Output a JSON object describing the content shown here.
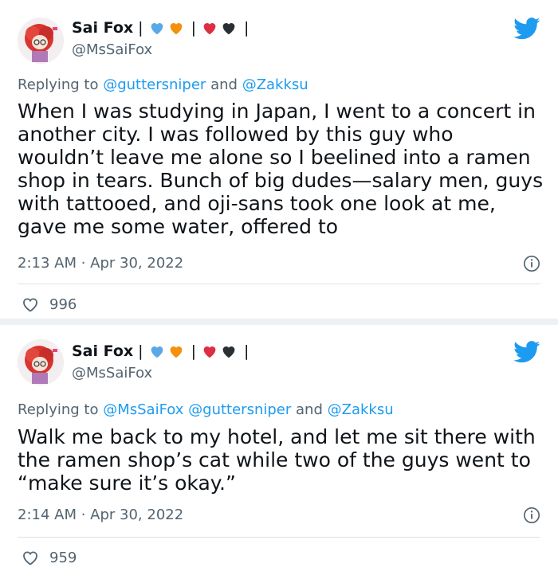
{
  "tweets": [
    {
      "name": "Sai Fox",
      "sep1": "|",
      "sep2": "|",
      "sep3": "|",
      "handle": "@MsSaiFox",
      "reply_prefix": "Replying to",
      "mentions": [
        "@guttersniper",
        "and",
        "@Zakksu"
      ],
      "text": "When I was studying in Japan, I went to a concert in another city. I was followed by this guy who wouldn’t leave me alone so I beelined into a ramen shop in tears. Bunch of big dudes—salary men, guys with tattooed, and oji-sans took one look at me, gave me some water, offered to",
      "timestamp": "2:13 AM · Apr 30, 2022",
      "likes": "996"
    },
    {
      "name": "Sai Fox",
      "sep1": "|",
      "sep2": "|",
      "sep3": "|",
      "handle": "@MsSaiFox",
      "reply_prefix": "Replying to",
      "mentions": [
        "@MsSaiFox",
        "@guttersniper",
        "and",
        "@Zakksu"
      ],
      "text": "Walk me back to my hotel, and let me sit there with the ramen shop’s cat while two of the guys went to “make sure it’s okay.”",
      "timestamp": "2:14 AM · Apr 30, 2022",
      "likes": "959"
    }
  ],
  "colors": {
    "accent": "#1d9bf0",
    "muted": "#536471",
    "heart_blue": "#5aa9e6",
    "heart_orange": "#f4900c",
    "heart_red": "#dd2e44",
    "heart_black": "#292f33"
  },
  "icons": [
    "twitter-bird-icon",
    "info-icon",
    "heart-icon",
    "blue-heart-emoji",
    "orange-heart-emoji",
    "red-heart-emoji",
    "black-heart-emoji"
  ]
}
